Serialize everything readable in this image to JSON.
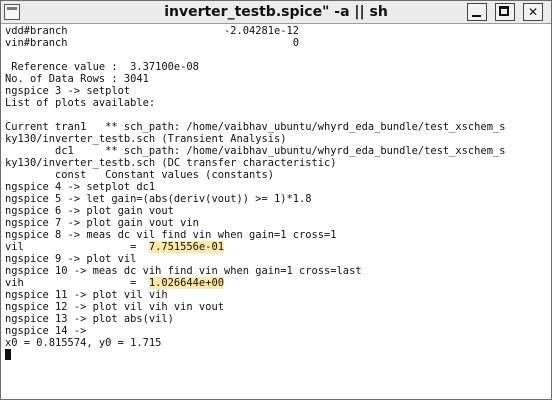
{
  "window": {
    "title": "inverter_testb.spice\" -a || sh",
    "minimize_label": "_",
    "maximize_label": "",
    "close_label": "✕",
    "icon": "terminal-app-icon"
  },
  "terminal": {
    "highlight_color": "#ffe9a8",
    "lines": [
      {
        "t": "vdd#branch                         -2.04281e-12"
      },
      {
        "t": "vin#branch                                    0"
      },
      {
        "t": ""
      },
      {
        "t": " Reference value :  3.37100e-08"
      },
      {
        "t": "No. of Data Rows : 3041"
      },
      {
        "t": "ngspice 3 -> setplot"
      },
      {
        "t": "List of plots available:"
      },
      {
        "t": ""
      },
      {
        "t": "Current tran1   ** sch_path: /home/vaibhav_ubuntu/whyrd_eda_bundle/test_xschem_s"
      },
      {
        "t": "ky130/inverter_testb.sch (Transient Analysis)"
      },
      {
        "t": "        dc1     ** sch_path: /home/vaibhav_ubuntu/whyrd_eda_bundle/test_xschem_s"
      },
      {
        "t": "ky130/inverter_testb.sch (DC transfer characteristic)"
      },
      {
        "t": "        const   Constant values (constants)"
      },
      {
        "t": "ngspice 4 -> setplot dc1"
      },
      {
        "t": "ngspice 5 -> let gain=(abs(deriv(vout)) >= 1)*1.8"
      },
      {
        "t": "ngspice 6 -> plot gain vout"
      },
      {
        "t": "ngspice 7 -> plot gain vout vin"
      },
      {
        "t": "ngspice 8 -> meas dc vil find vin when gain=1 cross=1"
      },
      {
        "pre": "vil                 =  ",
        "hl": "7.751556e-01"
      },
      {
        "t": "ngspice 9 -> plot vil"
      },
      {
        "t": "ngspice 10 -> meas dc vih find vin when gain=1 cross=last"
      },
      {
        "pre": "vih                 =  ",
        "hl": "1.026644e+00"
      },
      {
        "t": "ngspice 11 -> plot vil vih"
      },
      {
        "t": "ngspice 12 -> plot vil vih vin vout"
      },
      {
        "t": "ngspice 13 -> plot abs(vil)"
      },
      {
        "t": "ngspice 14 ->"
      },
      {
        "t": "x0 = 0.815574, y0 = 1.715"
      }
    ]
  }
}
